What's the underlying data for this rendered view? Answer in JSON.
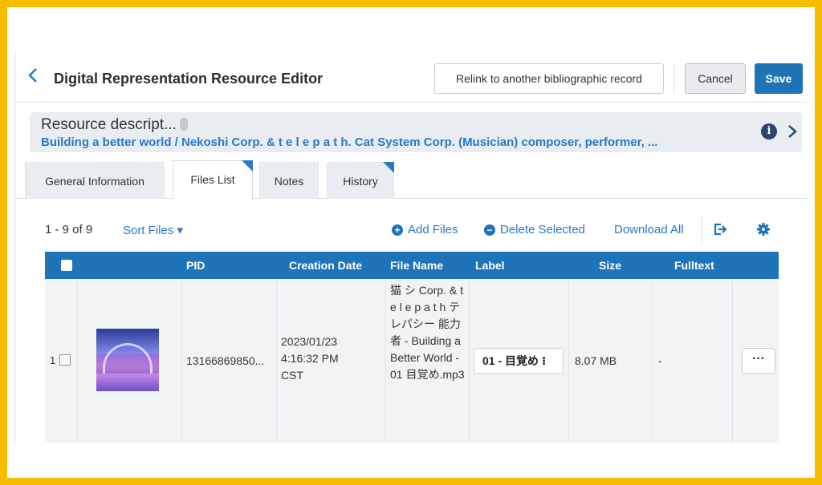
{
  "header": {
    "title": "Digital Representation Resource Editor",
    "relink_label": "Relink to another bibliographic record",
    "cancel_label": "Cancel",
    "save_label": "Save"
  },
  "resource": {
    "title": "Resource descript...",
    "subtitle": "Building a better world / Nekoshi Corp. & t e l e p a t h. Cat System Corp. (Musician) composer, performer, ...",
    "info_icon": "i"
  },
  "tabs": [
    {
      "label": "General Information"
    },
    {
      "label": "Files List",
      "active": true
    },
    {
      "label": "Notes"
    },
    {
      "label": "History"
    }
  ],
  "toolbar": {
    "count": "1 - 9 of 9",
    "sort_label": "Sort Files ▾",
    "add_files": "Add Files",
    "delete_selected": "Delete Selected",
    "download_all": "Download All"
  },
  "table": {
    "headers": [
      "PID",
      "Creation Date",
      "File Name",
      "Label",
      "Size",
      "Fulltext"
    ],
    "rows": [
      {
        "num": "1",
        "pid": "13166869850...",
        "creation_date": "2023/01/23 4:16:32 PM CST",
        "file_name": "猫 シ Corp. & t e l e p a t h テレパシー 能力者 - Building a Better World - 01 目覚め.mp3",
        "label": "01 - 目覚め",
        "size": "8.07 MB",
        "fulltext": "-",
        "more": "···"
      }
    ]
  },
  "colors": {
    "accent": "#1f73b7",
    "link": "#2a78c7",
    "frame": "#f5bc00"
  }
}
